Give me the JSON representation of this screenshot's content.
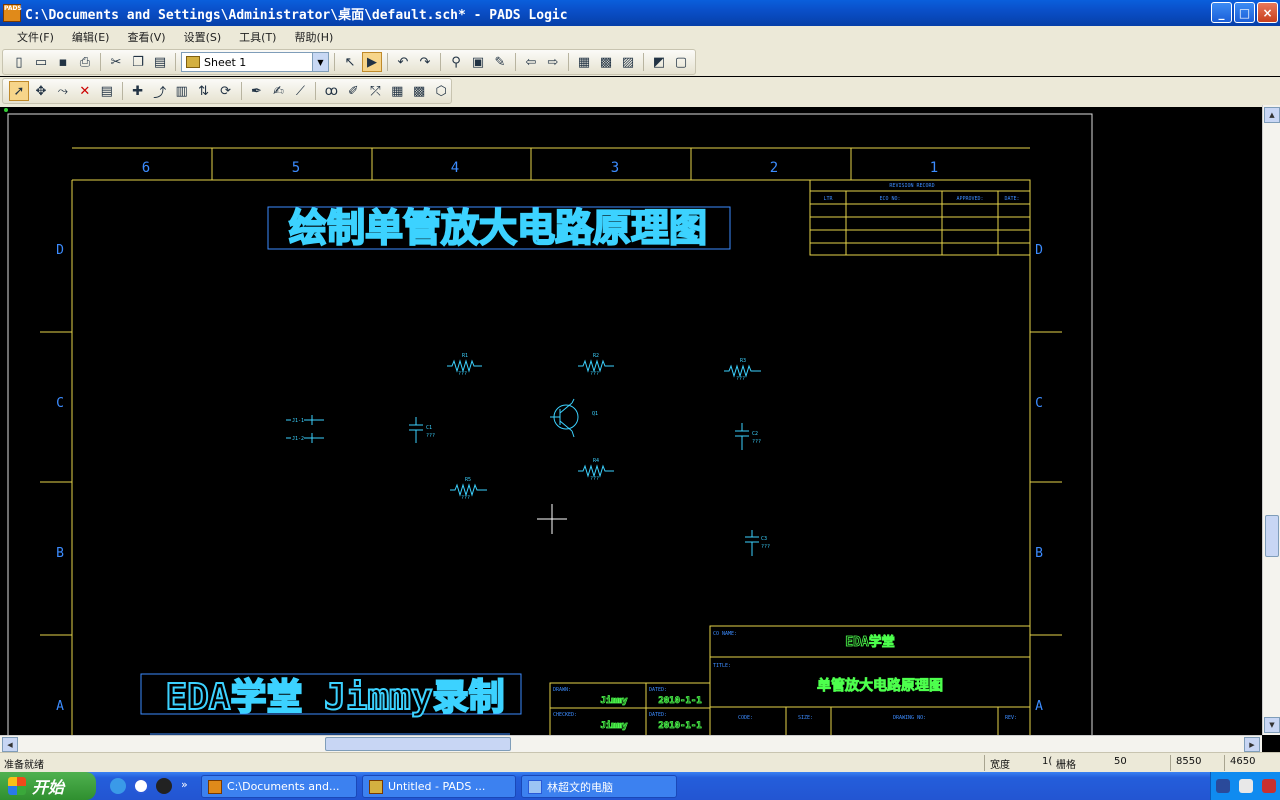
{
  "window": {
    "title": "C:\\Documents and Settings\\Administrator\\桌面\\default.sch* - PADS Logic",
    "app_icon": "PADS",
    "minimize": "_",
    "maximize": "□",
    "close": "×"
  },
  "menu": [
    "文件(F)",
    "编辑(E)",
    "查看(V)",
    "设置(S)",
    "工具(T)",
    "帮助(H)"
  ],
  "toolbar": {
    "sheet_selected": "Sheet 1"
  },
  "schematic": {
    "title_text": "绘制单管放大电路原理图",
    "watermark": "EDA学堂 Jimmy录制",
    "column_labels": [
      "6",
      "5",
      "4",
      "3",
      "2",
      "1"
    ],
    "row_labels": [
      "D",
      "C",
      "B",
      "A"
    ],
    "revision_header": "REVISION RECORD",
    "revision_cols": [
      "LTR",
      "ECO NO:",
      "APPROVED:",
      "DATE:"
    ],
    "company_label": "CO NAME:",
    "company_name": "EDA学堂",
    "title_label": "TITLE:",
    "drawing_title": "单管放大电路原理图",
    "drawn_label": "DRAWN:",
    "drawn_by": "Jimmy",
    "checked_label": "CHECKED:",
    "checked_by": "Jimmy",
    "dated_label": "DATED:",
    "date_value": "2010-1-1",
    "code_label": "CODE:",
    "size_label": "SIZE:",
    "drawing_no_label": "DRAWING NO:",
    "rev_label": "REV:",
    "components": {
      "r1_label": "R1",
      "r2_label": "R2",
      "r3_label": "R3",
      "r4_label": "R4",
      "r5_label": "R5",
      "c1_label": "C1",
      "c2_label": "C2",
      "c3_label": "C3",
      "q1_label": "Q1",
      "j1_label": "J1-1",
      "j2_label": "J1-2",
      "value_tag": "???"
    }
  },
  "status": {
    "ready": "准备就绪",
    "width_label": "宽度",
    "width_value": "1(",
    "grid_label": "栅格",
    "grid_value": "50",
    "x_coord": "8550",
    "y_coord": "4650"
  },
  "taskbar": {
    "start": "开始",
    "tasks": [
      "C:\\Documents and...",
      "Untitled - PADS ...",
      "林超文的电脑"
    ],
    "quicklaunch_more": "»"
  },
  "colors": {
    "border_yellow": "#e6d34a",
    "component_cyan": "#3cd2ff",
    "title_green": "#4dff4d",
    "canvas_bg": "#000000"
  }
}
